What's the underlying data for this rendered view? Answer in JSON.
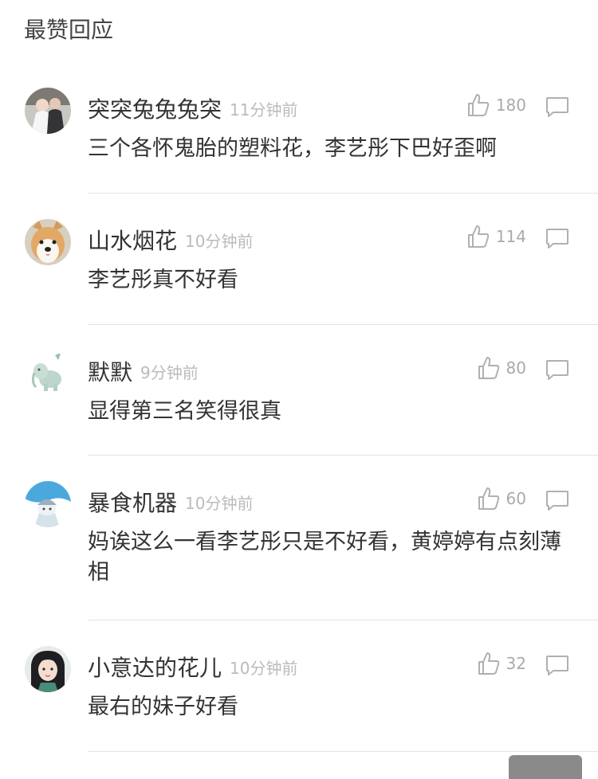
{
  "section": {
    "title": "最赞回应"
  },
  "comments": [
    {
      "username": "突突兔兔兔突",
      "time": "11分钟前",
      "likes": "180",
      "text": "三个各怀鬼胎的塑料花，李艺彤下巴好歪啊"
    },
    {
      "username": "山水烟花",
      "time": "10分钟前",
      "likes": "114",
      "text": "李艺彤真不好看"
    },
    {
      "username": "默默",
      "time": "9分钟前",
      "likes": "80",
      "text": "显得第三名笑得很真"
    },
    {
      "username": "暴食机器",
      "time": "10分钟前",
      "likes": "60",
      "text": "妈诶这么一看李艺彤只是不好看，黄婷婷有点刻薄相"
    },
    {
      "username": "小意达的花儿",
      "time": "10分钟前",
      "likes": "32",
      "text": "最右的妹子好看"
    }
  ],
  "icons": {
    "like": "thumbs-up-icon",
    "reply": "comment-bubble-icon"
  },
  "colors": {
    "text": "#333333",
    "meta": "#bbbbbb",
    "divider": "#e3e3e3"
  }
}
